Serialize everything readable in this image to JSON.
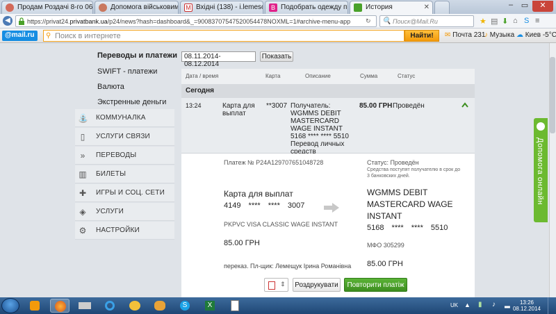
{
  "browser": {
    "tabs": [
      {
        "label": "Продам Роздачі 8-го 06.1...",
        "active": false
      },
      {
        "label": "Допомога військовим на ...",
        "active": false
      },
      {
        "label": "Вхідні (138) - i.lemeschuk...",
        "active": false
      },
      {
        "label": "Подобрать одежду по пар...",
        "active": false
      },
      {
        "label": "История",
        "active": true
      }
    ],
    "url_prefix": "https://privat24.",
    "url_domain": "privatbank.ua",
    "url_rest": "/p24/news?hash=dashboard&_=90083707547520054478NOXML=1#archive-menu-app",
    "search_placeholder": "Поиск@Mail.Ru"
  },
  "mailbar": {
    "logo": "@mail.ru",
    "search_placeholder": "Поиск в интернете",
    "search_button": "Найти!",
    "mail_label": "Почта 231",
    "music_label": "Музыка",
    "weather_label": "Киев -5°C"
  },
  "sidebar": {
    "subitems": [
      "Переводы и платежи",
      "SWIFT - платежи",
      "Валюта",
      "Экстренные деньги"
    ],
    "items": [
      "Коммуналка",
      "Услуги связи",
      "Переводы",
      "Билеты",
      "Игры и соц. сети",
      "Услуги",
      "Настройки"
    ]
  },
  "filter": {
    "date_range": "08.11.2014-08.12.2014",
    "show_button": "Показать"
  },
  "table": {
    "headers": [
      "Дата / время",
      "Карта",
      "Описание",
      "Сумма",
      "Статус"
    ],
    "group": "Сегодня",
    "row": {
      "time": "13:24",
      "card_line1": "Карта для",
      "card_line2": "выплат",
      "card_num": "**3007",
      "desc_lines": [
        "Получатель:",
        "WGMMS DEBIT",
        "MASTERCARD",
        "WAGE INSTANT",
        "5168 **** **** 5510",
        "Перевод личных",
        "средств"
      ],
      "amount_value": "85.00",
      "amount_currency": "ГРН",
      "status": "Проведён"
    }
  },
  "detail": {
    "payment_no": "Платеж № P24A129707651048728",
    "status": "Статус: Проведён",
    "note_line1": "Средства поступят получателю в срок до",
    "note_line2": "3 банковских дней.",
    "from_title": "Карта для выплат",
    "from_num_a": "4149",
    "from_num_b": "****",
    "from_num_c": "****",
    "from_num_d": "3007",
    "from_type": "PKPVC VISA CLASSIC WAGE INSTANT",
    "from_amount": "85.00 ГРН",
    "to_line1": "WGMMS DEBIT",
    "to_line2": "MASTERCARD WAGE",
    "to_line3": "INSTANT",
    "to_num_a": "5168",
    "to_num_b": "****",
    "to_num_c": "****",
    "to_num_d": "5510",
    "mfo": "МФО 305299",
    "to_amount": "85.00 ГРН",
    "payer": "переказ. Пл-щик: Лемещук Ірина Романівна",
    "print_button": "Роздрукувати",
    "repeat_button": "Повторити платіж"
  },
  "help_tab": "Допомога онлайн",
  "taskbar": {
    "lang": "UK",
    "time": "13:26",
    "date": "08.12.2014"
  },
  "colors": {
    "accent_green": "#4aa12a",
    "status_green": "#3d8e20"
  }
}
